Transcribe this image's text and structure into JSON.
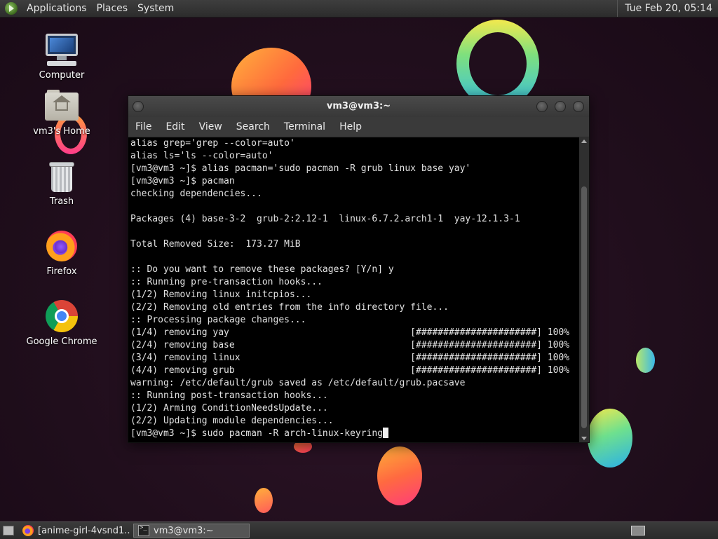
{
  "top_panel": {
    "menus": [
      "Applications",
      "Places",
      "System"
    ],
    "clock": "Tue Feb 20, 05:14"
  },
  "desktop": {
    "icons": [
      {
        "label": "Computer",
        "icon": "computer-icon"
      },
      {
        "label": "vm3's Home",
        "icon": "home-folder-icon"
      },
      {
        "label": "Trash",
        "icon": "trash-icon"
      },
      {
        "label": "Firefox",
        "icon": "firefox-icon"
      },
      {
        "label": "Google Chrome",
        "icon": "chrome-icon"
      }
    ]
  },
  "terminal": {
    "title": "vm3@vm3:~",
    "menu": [
      "File",
      "Edit",
      "View",
      "Search",
      "Terminal",
      "Help"
    ],
    "lines": [
      "alias grep='grep --color=auto'",
      "alias ls='ls --color=auto'",
      "[vm3@vm3 ~]$ alias pacman='sudo pacman -R grub linux base yay'",
      "[vm3@vm3 ~]$ pacman",
      "checking dependencies...",
      "",
      "Packages (4) base-3-2  grub-2:2.12-1  linux-6.7.2.arch1-1  yay-12.1.3-1",
      "",
      "Total Removed Size:  173.27 MiB",
      "",
      ":: Do you want to remove these packages? [Y/n] y",
      ":: Running pre-transaction hooks...",
      "(1/2) Removing linux initcpios...",
      "(2/2) Removing old entries from the info directory file...",
      ":: Processing package changes...",
      "(1/4) removing yay                                 [######################] 100%",
      "(2/4) removing base                                [######################] 100%",
      "(3/4) removing linux                               [######################] 100%",
      "(4/4) removing grub                                [######################] 100%",
      "warning: /etc/default/grub saved as /etc/default/grub.pacsave",
      ":: Running post-transaction hooks...",
      "(1/2) Arming ConditionNeedsUpdate...",
      "(2/2) Updating module dependencies...",
      "[vm3@vm3 ~]$ sudo pacman -R arch-linux-keyring"
    ]
  },
  "taskbar": {
    "tasks": [
      {
        "label": "[anime-girl-4vsnd1...",
        "icon": "firefox-icon",
        "active": false
      },
      {
        "label": "vm3@vm3:~",
        "icon": "terminal-icon",
        "active": true
      }
    ]
  }
}
